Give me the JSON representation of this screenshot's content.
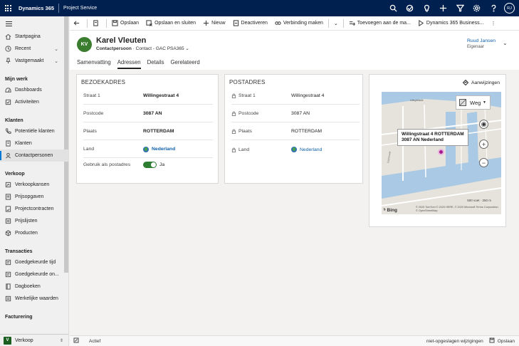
{
  "topbar": {
    "brand": "Dynamics 365",
    "app": "Project Service",
    "icons": [
      "search-icon",
      "target-icon",
      "lightbulb-icon",
      "plus-icon",
      "filter-icon",
      "gear-icon",
      "help-icon"
    ],
    "user_initials": "RJ"
  },
  "sidebar": {
    "items": [
      {
        "label": "Startpagina",
        "icon": "home-icon"
      },
      {
        "label": "Recent",
        "icon": "clock-icon"
      },
      {
        "label": "Vastgemaakt",
        "icon": "pin-icon"
      }
    ],
    "groups": [
      {
        "title": "Mijn werk",
        "items": [
          {
            "label": "Dashboards",
            "icon": "dashboard-icon"
          },
          {
            "label": "Activiteiten",
            "icon": "activity-icon"
          }
        ]
      },
      {
        "title": "Klanten",
        "items": [
          {
            "label": "Potentiële klanten",
            "icon": "phone-icon"
          },
          {
            "label": "Klanten",
            "icon": "building-icon"
          },
          {
            "label": "Contactpersonen",
            "icon": "person-icon"
          }
        ]
      },
      {
        "title": "Verkoop",
        "items": [
          {
            "label": "Verkoopkansen",
            "icon": "opportunity-icon"
          },
          {
            "label": "Prijsopgaven",
            "icon": "quote-icon"
          },
          {
            "label": "Projectcontracten",
            "icon": "contract-icon"
          },
          {
            "label": "Prijslijsten",
            "icon": "pricelist-icon"
          },
          {
            "label": "Producten",
            "icon": "product-icon"
          }
        ]
      },
      {
        "title": "Transacties",
        "items": [
          {
            "label": "Goedgekeurde tijd",
            "icon": "time-icon"
          },
          {
            "label": "Goedgekeurde on...",
            "icon": "expense-icon"
          },
          {
            "label": "Dagboeken",
            "icon": "journal-icon"
          },
          {
            "label": "Werkelijke waarden",
            "icon": "actuals-icon"
          }
        ]
      },
      {
        "title": "Facturering",
        "items": []
      }
    ],
    "area": {
      "badge": "V",
      "label": "Verkoop"
    }
  },
  "commandbar": {
    "back": "back-icon",
    "items": [
      "Opslaan",
      "Opslaan en sluiten",
      "Nieuw",
      "Deactiveren",
      "Verbinding maken",
      "Toevoegen aan de ma...",
      "Dynamics 365 Business..."
    ]
  },
  "record": {
    "initials": "KV",
    "name": "Karel Vleuten",
    "entity": "Contactpersoon",
    "form": "Contact - GAC PSA365",
    "owner_name": "Ruud Jansen",
    "owner_label": "Eigenaar"
  },
  "tabs": [
    "Samenvatting",
    "Adressen",
    "Details",
    "Gerelateerd"
  ],
  "active_tab": "Adressen",
  "visit_address": {
    "title": "BEZOEKADRES",
    "fields": [
      {
        "label": "Straat 1",
        "value": "Willingestraat 4"
      },
      {
        "label": "Postcode",
        "value": "3087 AN"
      },
      {
        "label": "Plaats",
        "value": "ROTTERDAM"
      },
      {
        "label": "Land",
        "value": "Nederland"
      },
      {
        "label": "Gebruik als postadres",
        "value": "Ja"
      }
    ]
  },
  "postal_address": {
    "title": "POSTADRES",
    "fields": [
      {
        "label": "Straat 1",
        "value": "Willingestraat 4"
      },
      {
        "label": "Postcode",
        "value": "3087 AN"
      },
      {
        "label": "Plaats",
        "value": "ROTTERDAM"
      },
      {
        "label": "Land",
        "value": "Nederland"
      }
    ]
  },
  "map": {
    "directions_label": "Aanwijzingen",
    "map_type": "Weg",
    "popup_line1": "Willingstraat 4 ROTTERDAM",
    "popup_line2": "3087 AN Nederland",
    "bing": "Bing",
    "copyright": "© 2020 TomTom © 2020 HERE, © 2020 Microsoft Terms Corporation © OpenStreetMap",
    "scale": "250 m",
    "scale_alt": "500 voet",
    "area_label": "Uitsyblade"
  },
  "status": {
    "state": "Actief",
    "unsaved": "niet-opgeslagen wijzigingen",
    "save": "Opslaan"
  },
  "colors": {
    "topbar": "#002050",
    "accent": "#0078d4",
    "avatar": "#3a7d2f",
    "toggle": "#2e7d32",
    "pin": "#a31d8f"
  }
}
